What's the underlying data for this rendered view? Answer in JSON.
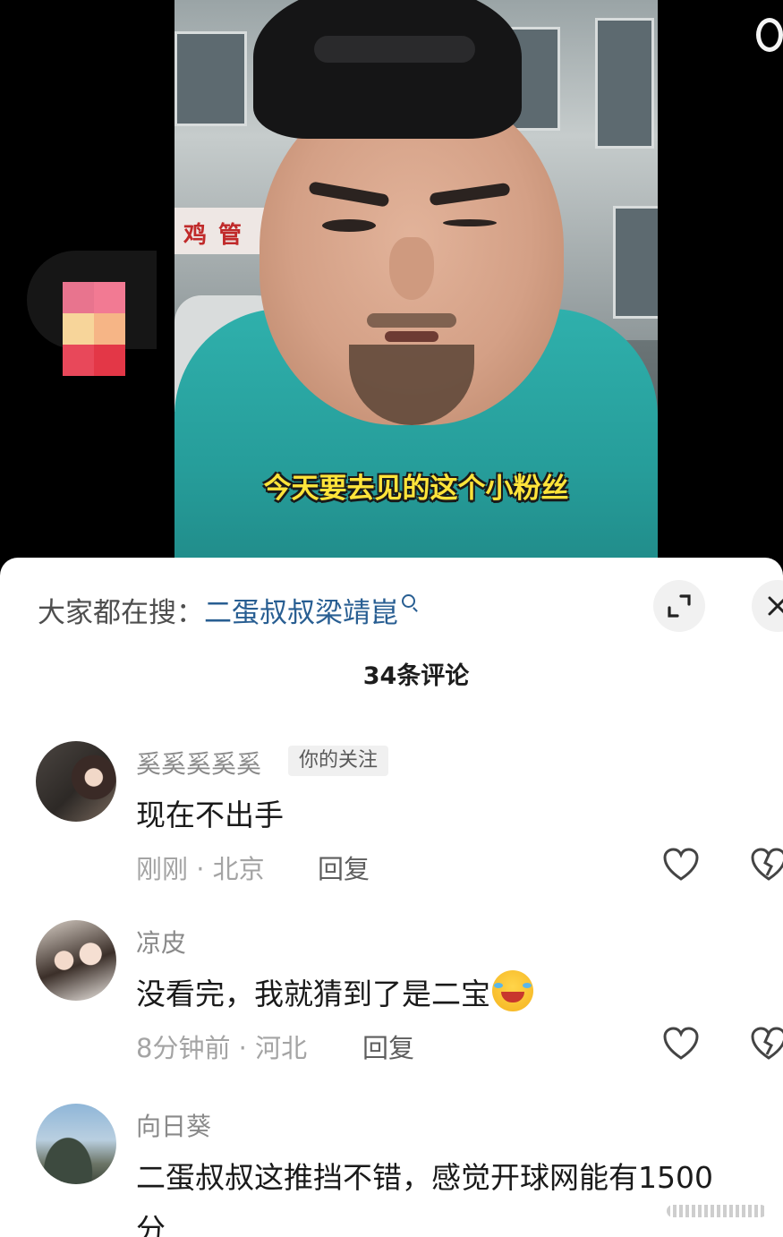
{
  "video": {
    "subtitle": "今天要去见的这个小粉丝",
    "sign_text": "鸡 管"
  },
  "sheet": {
    "search_prefix": "大家都在搜：",
    "search_term": "二蛋叔叔梁靖崑",
    "comment_count": "34条评论"
  },
  "comments": [
    {
      "username": "奚奚奚奚奚",
      "badge": "你的关注",
      "text": "现在不出手",
      "meta": "刚刚 · 北京",
      "reply": "回复"
    },
    {
      "username": "凉皮",
      "text": "没看完，我就猜到了是二宝",
      "emoji": "grinning-squinting-laugh-emoji",
      "meta": "8分钟前 · 河北",
      "reply": "回复"
    },
    {
      "username": "向日葵",
      "text_line1": "二蛋叔叔这推挡不错，感觉开球网能有1500",
      "text_line2": "分"
    }
  ],
  "colors": {
    "search_term": "#285e92",
    "subtitle": "#ffe43a",
    "shirt": "#2fb0ac"
  }
}
